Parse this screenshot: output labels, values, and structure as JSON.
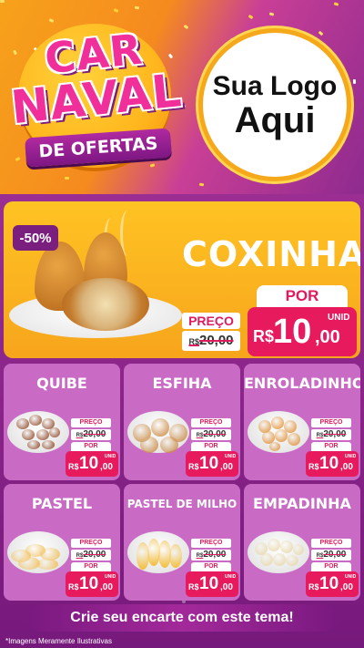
{
  "header": {
    "badge": {
      "line1": "CAR",
      "line2": "NAVAL",
      "line3": "DE OFERTAS"
    },
    "logo": {
      "line1": "Sua Logo",
      "line2": "Aqui"
    }
  },
  "featured": {
    "discount": "-50%",
    "name": "COXINHA",
    "price_label": "PREÇO",
    "old_currency": "R$",
    "old_price": "20,00",
    "new_label": "POR",
    "currency": "R$",
    "new_int": "10",
    "new_dec": ",00",
    "unit": "UNID"
  },
  "products": [
    {
      "name": "QUIBE",
      "price_label": "PREÇO",
      "old_currency": "R$",
      "old_price": "20,00",
      "new_label": "POR",
      "currency": "R$",
      "new_int": "10",
      "new_dec": ",00",
      "unit": "UNID"
    },
    {
      "name": "ESFIHA",
      "price_label": "PREÇO",
      "old_currency": "R$",
      "old_price": "20,00",
      "new_label": "POR",
      "currency": "R$",
      "new_int": "10",
      "new_dec": ",00",
      "unit": "UNID"
    },
    {
      "name": "ENROLADINHO",
      "price_label": "PREÇO",
      "old_currency": "R$",
      "old_price": "20,00",
      "new_label": "POR",
      "currency": "R$",
      "new_int": "10",
      "new_dec": ",00",
      "unit": "UNID"
    },
    {
      "name": "PASTEL",
      "price_label": "PREÇO",
      "old_currency": "R$",
      "old_price": "20,00",
      "new_label": "POR",
      "currency": "R$",
      "new_int": "10",
      "new_dec": ",00",
      "unit": "UNID"
    },
    {
      "name": "PASTEL DE MILHO",
      "price_label": "PREÇO",
      "old_currency": "R$",
      "old_price": "20,00",
      "new_label": "POR",
      "currency": "R$",
      "new_int": "10",
      "new_dec": ",00",
      "unit": "UNID"
    },
    {
      "name": "EMPADINHA",
      "price_label": "PREÇO",
      "old_currency": "R$",
      "old_price": "20,00",
      "new_label": "POR",
      "currency": "R$",
      "new_int": "10",
      "new_dec": ",00",
      "unit": "UNID"
    }
  ],
  "footer": {
    "cta": "Crie seu encarte com este tema!",
    "disclaimer": "*Imagens Meramente Ilustrativas"
  },
  "colors": {
    "purple": "#7a1f7e",
    "pink_price": "#e81a5e",
    "orange": "#f7a21b",
    "card": "#c96bc5",
    "featured_bg": "#ffc323"
  }
}
